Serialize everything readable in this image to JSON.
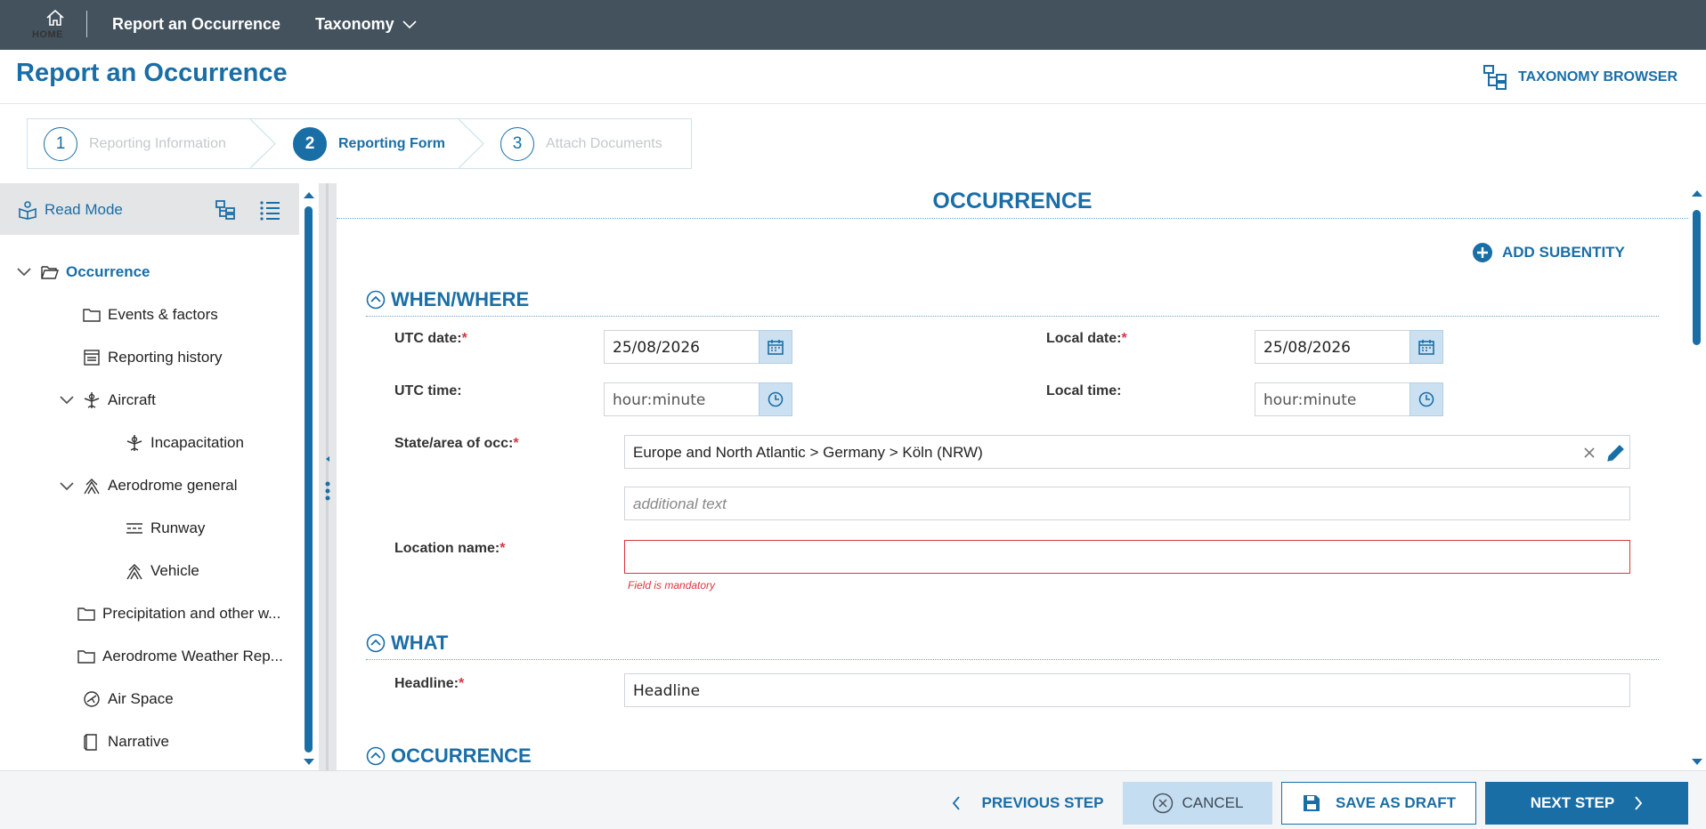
{
  "topbar": {
    "home_label": "HOME",
    "nav_report": "Report an Occurrence",
    "nav_taxonomy": "Taxonomy"
  },
  "header": {
    "title": "Report an Occurrence",
    "taxonomy_browser": "TAXONOMY BROWSER"
  },
  "steps": [
    {
      "num": "1",
      "label": "Reporting Information",
      "state": "completed"
    },
    {
      "num": "2",
      "label": "Reporting Form",
      "state": "active"
    },
    {
      "num": "3",
      "label": "Attach Documents",
      "state": "pending"
    }
  ],
  "sidebar": {
    "read_mode": "Read Mode",
    "tree": [
      {
        "label": "Occurrence",
        "icon": "folder-open-icon"
      },
      {
        "label": "Events & factors",
        "icon": "folder-icon"
      },
      {
        "label": "Reporting history",
        "icon": "report-icon"
      },
      {
        "label": "Aircraft",
        "icon": "aircraft-icon"
      },
      {
        "label": "Incapacitation",
        "icon": "aircraft-icon"
      },
      {
        "label": "Aerodrome general",
        "icon": "aerodrome-icon"
      },
      {
        "label": "Runway",
        "icon": "runway-icon"
      },
      {
        "label": "Vehicle",
        "icon": "aerodrome-icon"
      },
      {
        "label": "Precipitation and other w...",
        "icon": "folder-icon"
      },
      {
        "label": "Aerodrome Weather Rep...",
        "icon": "folder-icon"
      },
      {
        "label": "Air Space",
        "icon": "airspace-icon"
      },
      {
        "label": "Narrative",
        "icon": "narrative-icon"
      }
    ]
  },
  "main": {
    "section_title": "OCCURRENCE",
    "add_subentity": "ADD SUBENTITY",
    "groups": {
      "when_where": "WHEN/WHERE",
      "what": "WHAT",
      "occurrence": "OCCURRENCE"
    },
    "fields": {
      "utc_date_label": "UTC date:",
      "utc_date_value": "25/08/2026",
      "local_date_label": "Local date:",
      "local_date_value": "25/08/2026",
      "utc_time_label": "UTC time:",
      "utc_time_value": "hour:minute",
      "local_time_label": "Local time:",
      "local_time_value": "hour:minute",
      "state_label": "State/area of occ:",
      "state_value": "Europe and North Atlantic > Germany > Köln (NRW)",
      "additional_text_placeholder": "additional text",
      "location_label": "Location name:",
      "location_value": "",
      "location_error": "Field is mandatory",
      "headline_label": "Headline:",
      "headline_value": "Headline"
    },
    "required_mark": "*"
  },
  "footer": {
    "previous": "PREVIOUS STEP",
    "cancel": "CANCEL",
    "save_draft": "SAVE AS DRAFT",
    "next": "NEXT STEP"
  },
  "colors": {
    "primary": "#1a6ea6",
    "topbar": "#43525d",
    "error": "#d9363e"
  }
}
